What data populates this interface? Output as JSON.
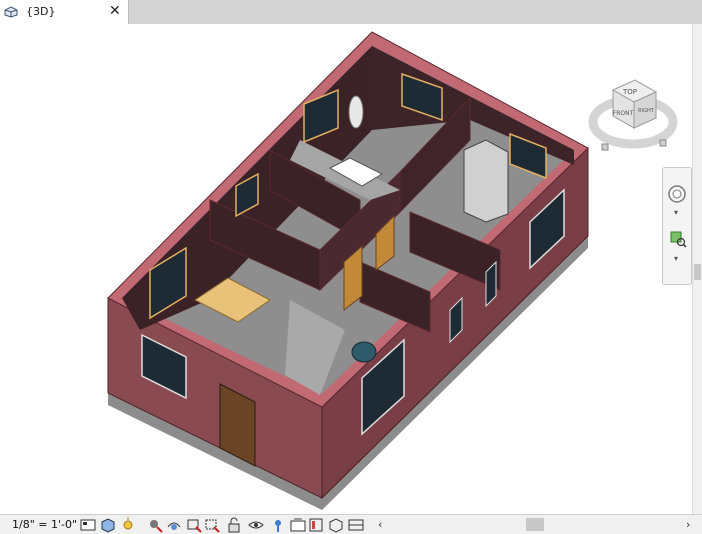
{
  "tab": {
    "title": "{3D}",
    "close_glyph": "✕",
    "icon": "3d-view-icon"
  },
  "viewcube": {
    "top_label": "TOP",
    "front_label": "FRONT",
    "right_label": "RIGHT"
  },
  "navbar": {
    "icons": [
      "steering-wheel-icon",
      "zoom-region-icon"
    ]
  },
  "status": {
    "scale": "1/8\" = 1'-0\""
  },
  "view_controls": {
    "icons": [
      "detail-level-icon",
      "visual-style-icon",
      "sun-path-icon",
      "shadows-icon",
      "show-rendering-icon",
      "crop-view-icon",
      "show-crop-icon",
      "unlock-3d-view-icon",
      "temporary-hide-icon",
      "reveal-hidden-icon",
      "temporary-view-properties-icon",
      "worksharing-display-icon",
      "analytical-model-icon",
      "highlight-displacement-icon",
      "reveal-constraints-icon"
    ]
  },
  "scrollbar": {
    "left_arrow": "‹",
    "right_arrow": "›"
  },
  "colors": {
    "wall_exterior": "#8a4a52",
    "wall_top": "#c26a74",
    "wall_interior": "#3a2226",
    "floor": "#9a9a9a",
    "table": "#e9c27a",
    "door": "#6a4424"
  }
}
